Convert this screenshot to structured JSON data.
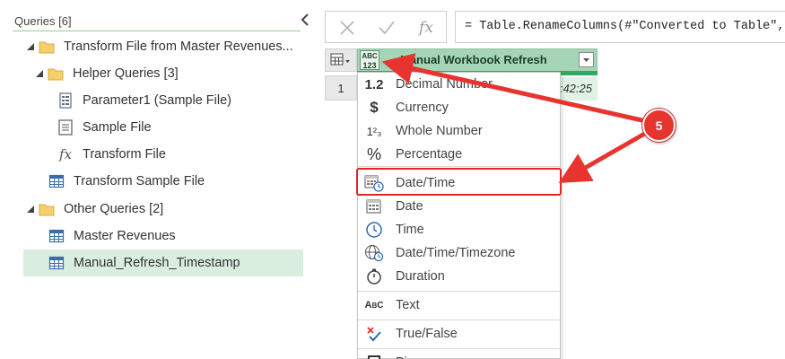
{
  "queries_pane": {
    "header": "Queries [6]",
    "tree": [
      {
        "label": "Transform File from Master Revenues...",
        "kind": "folder",
        "expanded": true
      },
      {
        "label": "Helper Queries [3]",
        "kind": "folder",
        "expanded": true
      },
      {
        "label": "Parameter1 (Sample File)",
        "kind": "parameter"
      },
      {
        "label": "Sample File",
        "kind": "file"
      },
      {
        "label": "Transform File",
        "kind": "function"
      },
      {
        "label": "Transform Sample File",
        "kind": "table"
      },
      {
        "label": "Other Queries [2]",
        "kind": "folder",
        "expanded": true
      },
      {
        "label": "Master Revenues",
        "kind": "table"
      },
      {
        "label": "Manual_Refresh_Timestamp",
        "kind": "table",
        "selected": true
      }
    ]
  },
  "formula_bar": {
    "formula": "= Table.RenameColumns(#\"Converted to Table\","
  },
  "grid": {
    "type_icon_top": "ABC",
    "type_icon_bottom": "123",
    "column_title": "Manual Workbook Refresh",
    "row_number": "1",
    "cell_value": ":42:25"
  },
  "type_menu": {
    "items": [
      {
        "label": "Decimal Number",
        "icon": "1.2"
      },
      {
        "label": "Currency",
        "icon": "$"
      },
      {
        "label": "Whole Number",
        "icon": "1²3"
      },
      {
        "label": "Percentage",
        "icon": "%"
      },
      {
        "label": "Date/Time",
        "icon": "calendar-clock",
        "highlighted": true
      },
      {
        "label": "Date",
        "icon": "calendar"
      },
      {
        "label": "Time",
        "icon": "clock"
      },
      {
        "label": "Date/Time/Timezone",
        "icon": "globe-clock"
      },
      {
        "label": "Duration",
        "icon": "stopwatch"
      },
      {
        "label": "Text",
        "icon": "ABC"
      },
      {
        "label": "True/False",
        "icon": "check-cross"
      },
      {
        "label": "Bi",
        "icon": "binary"
      }
    ]
  },
  "annotation": {
    "step_number": "5",
    "color": "#e8342f"
  },
  "colors": {
    "accent_green": "#2eaa62",
    "selection_green": "#d9eedf",
    "highlight_red": "#e0262b"
  }
}
